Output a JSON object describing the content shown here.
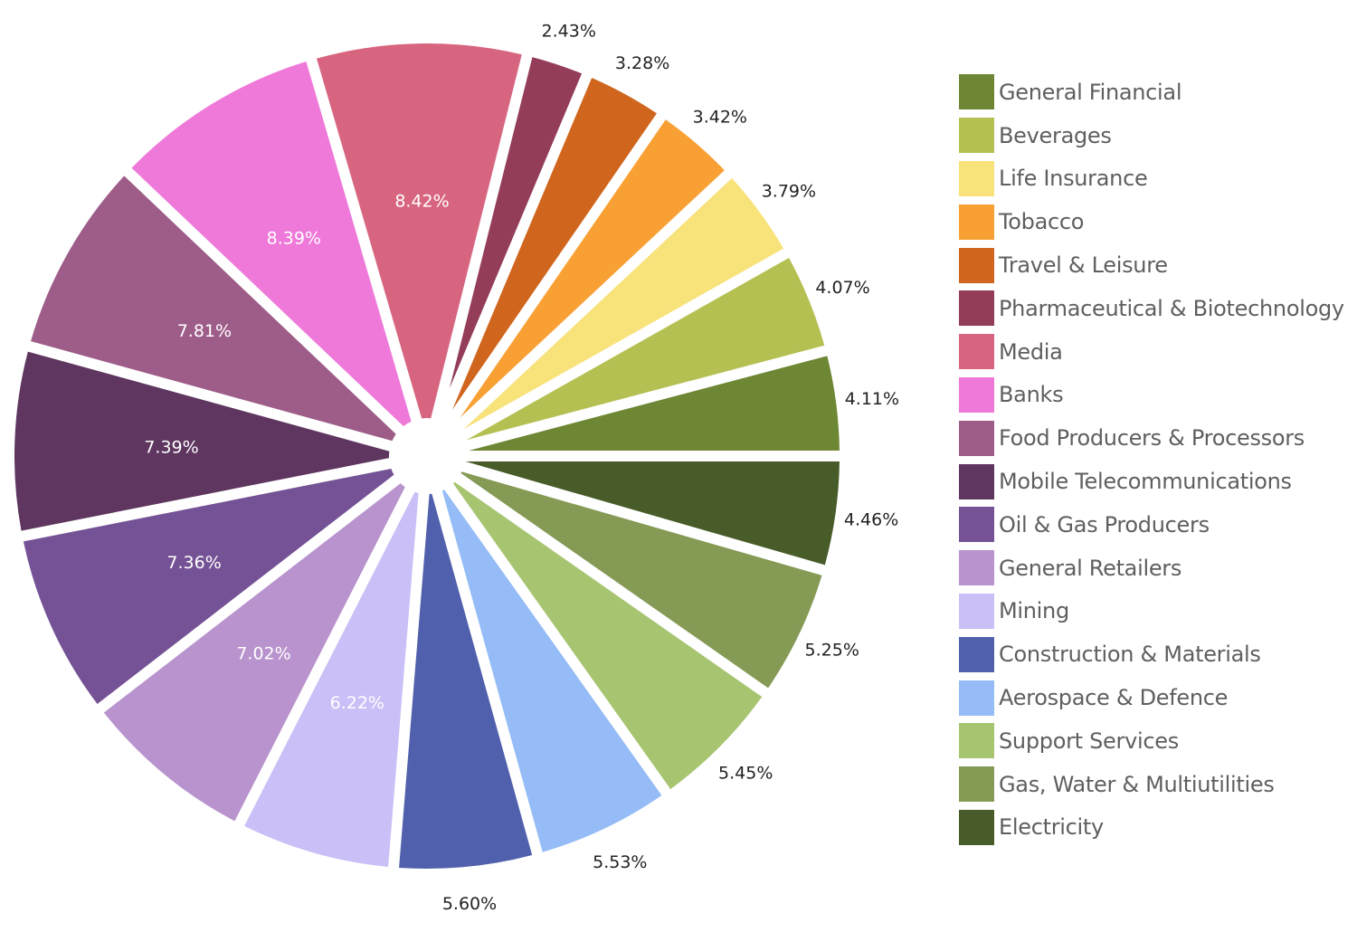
{
  "chart_data": {
    "type": "pie",
    "title": "",
    "unit": "%",
    "legend_position": "right",
    "start_angle_deg": 0,
    "direction": "counterclockwise",
    "slices": [
      {
        "label": "General Financial",
        "value": 4.11,
        "display": "4.11%",
        "color": "#6e8734",
        "label_position": "outside"
      },
      {
        "label": "Beverages",
        "value": 4.07,
        "display": "4.07%",
        "color": "#b5c052",
        "label_position": "outside"
      },
      {
        "label": "Life Insurance",
        "value": 3.79,
        "display": "3.79%",
        "color": "#f8e27a",
        "label_position": "outside"
      },
      {
        "label": "Tobacco",
        "value": 3.42,
        "display": "3.42%",
        "color": "#f9a035",
        "label_position": "outside"
      },
      {
        "label": "Travel & Leisure",
        "value": 3.28,
        "display": "3.28%",
        "color": "#d0661d",
        "label_position": "outside"
      },
      {
        "label": "Pharmaceutical & Biotechnology",
        "value": 2.43,
        "display": "2.43%",
        "color": "#943d58",
        "label_position": "outside"
      },
      {
        "label": "Media",
        "value": 8.42,
        "display": "8.42%",
        "color": "#d8657f",
        "label_position": "inside"
      },
      {
        "label": "Banks",
        "value": 8.39,
        "display": "8.39%",
        "color": "#ef79d9",
        "label_position": "inside"
      },
      {
        "label": "Food Producers & Processors",
        "value": 7.81,
        "display": "7.81%",
        "color": "#9e5d89",
        "label_position": "inside"
      },
      {
        "label": "Mobile Telecommunications",
        "value": 7.39,
        "display": "7.39%",
        "color": "#5e365f",
        "label_position": "inside"
      },
      {
        "label": "Oil & Gas Producers",
        "value": 7.36,
        "display": "7.36%",
        "color": "#755295",
        "label_position": "inside"
      },
      {
        "label": "General Retailers",
        "value": 7.02,
        "display": "7.02%",
        "color": "#b893cd",
        "label_position": "inside"
      },
      {
        "label": "Mining",
        "value": 6.22,
        "display": "6.22%",
        "color": "#cbbff7",
        "label_position": "inside"
      },
      {
        "label": "Construction & Materials",
        "value": 5.6,
        "display": "5.60%",
        "color": "#5060ac",
        "label_position": "outside"
      },
      {
        "label": "Aerospace & Defence",
        "value": 5.53,
        "display": "5.53%",
        "color": "#95bcf6",
        "label_position": "outside"
      },
      {
        "label": "Support Services",
        "value": 5.45,
        "display": "5.45%",
        "color": "#a7c571",
        "label_position": "outside"
      },
      {
        "label": "Gas, Water & Multiutilities",
        "value": 5.25,
        "display": "5.25%",
        "color": "#859a55",
        "label_position": "outside"
      },
      {
        "label": "Electricity",
        "value": 4.46,
        "display": "4.46%",
        "color": "#485c29",
        "label_position": "outside"
      }
    ]
  }
}
